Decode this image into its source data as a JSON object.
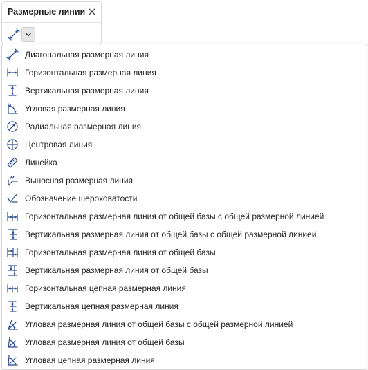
{
  "colors": {
    "accent": "#2a4d8f",
    "border": "#d6d6d6",
    "toggle_bg": "#e6e6e6"
  },
  "panel": {
    "title": "Размерные линии",
    "close_icon": "close-icon",
    "tool_icon": "dimension-diagonal-icon",
    "dropdown_icon": "chevron-down-icon"
  },
  "menu": {
    "items": [
      {
        "label": "Диагональная размерная линия",
        "icon": "dimension-diagonal-icon"
      },
      {
        "label": "Горизонтальная размерная линия",
        "icon": "dimension-horizontal-icon"
      },
      {
        "label": "Вертикальная размерная линия",
        "icon": "dimension-vertical-icon"
      },
      {
        "label": "Угловая размерная линия",
        "icon": "dimension-angular-icon"
      },
      {
        "label": "Радиальная размерная линия",
        "icon": "dimension-radial-icon"
      },
      {
        "label": "Центровая линия",
        "icon": "center-line-icon"
      },
      {
        "label": "Линейка",
        "icon": "ruler-icon"
      },
      {
        "label": "Выносная размерная линия",
        "icon": "leader-line-icon"
      },
      {
        "label": "Обозначение шероховатости",
        "icon": "roughness-icon"
      },
      {
        "label": "Горизонтальная размерная линия от общей базы с общей размерной линией",
        "icon": "horizontal-baseline-common-icon"
      },
      {
        "label": "Вертикальная размерная линия от общей базы с общей размерной линией",
        "icon": "vertical-baseline-common-icon"
      },
      {
        "label": "Горизонтальная размерная линия от общей базы",
        "icon": "horizontal-baseline-icon"
      },
      {
        "label": "Вертикальная размерная линия от общей базы",
        "icon": "vertical-baseline-icon"
      },
      {
        "label": "Горизонтальная цепная размерная линия",
        "icon": "horizontal-chain-icon"
      },
      {
        "label": "Вертикальная цепная размерная линия",
        "icon": "vertical-chain-icon"
      },
      {
        "label": "Угловая размерная линия от общей базы с общей размерной линией",
        "icon": "angular-baseline-common-icon"
      },
      {
        "label": "Угловая размерная линия от общей базы",
        "icon": "angular-baseline-icon"
      },
      {
        "label": "Угловая цепная размерная линия",
        "icon": "angular-chain-icon"
      }
    ]
  }
}
